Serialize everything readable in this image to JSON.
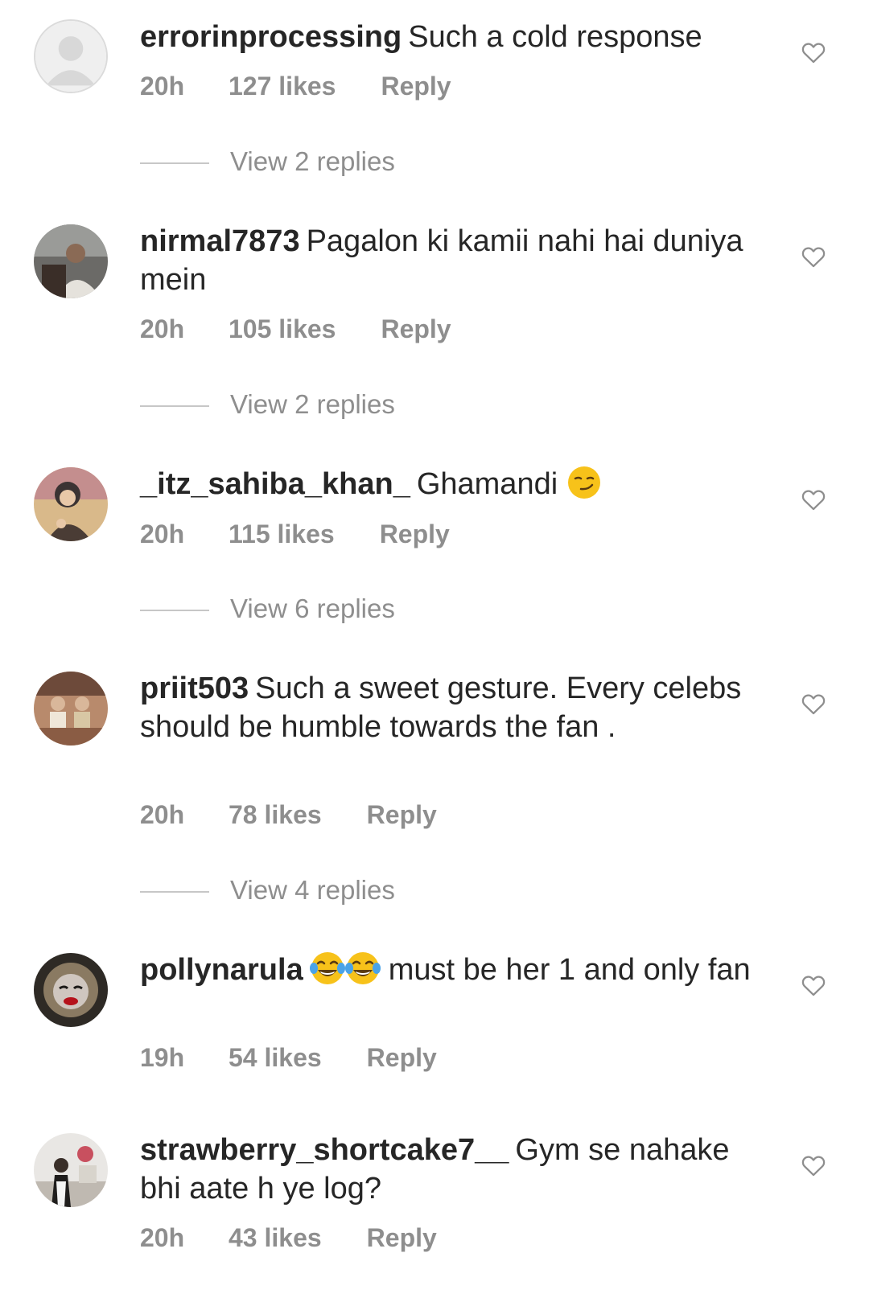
{
  "comments": [
    {
      "username": "errorinprocessing",
      "text": "Such a cold response",
      "time": "20h",
      "likes": "127 likes",
      "reply": "Reply",
      "view_replies": "View 2 replies",
      "avatar": "default-avatar-icon"
    },
    {
      "username": "nirmal7873",
      "text": "Pagalon ki kamii nahi hai duniya mein",
      "time": "20h",
      "likes": "105 likes",
      "reply": "Reply",
      "view_replies": "View 2 replies",
      "avatar": "user-photo"
    },
    {
      "username": "_itz_sahiba_khan_",
      "text": "Ghamandi",
      "emoji": "smirk-emoji",
      "time": "20h",
      "likes": "115 likes",
      "reply": "Reply",
      "view_replies": "View 6 replies",
      "avatar": "user-photo"
    },
    {
      "username": "priit503",
      "text": "Such a sweet gesture. Every celebs should be humble towards the fan .",
      "time": "20h",
      "likes": "78 likes",
      "reply": "Reply",
      "view_replies": "View 4 replies",
      "avatar": "user-photo"
    },
    {
      "username": "pollynarula",
      "emoji": "tears-of-joy-emoji x2",
      "text": "must be her 1 and only fan",
      "time": "19h",
      "likes": "54 likes",
      "reply": "Reply",
      "avatar": "user-photo"
    },
    {
      "username": "strawberry_shortcake7__",
      "text": "Gym se nahake bhi aate h ye log?",
      "time": "20h",
      "likes": "43 likes",
      "reply": "Reply",
      "avatar": "user-photo"
    }
  ],
  "icons": {
    "like": "heart-outline-icon"
  },
  "colors": {
    "text": "#262626",
    "meta": "#8e8e8e",
    "rule": "#c7c7c7",
    "background": "#ffffff"
  }
}
